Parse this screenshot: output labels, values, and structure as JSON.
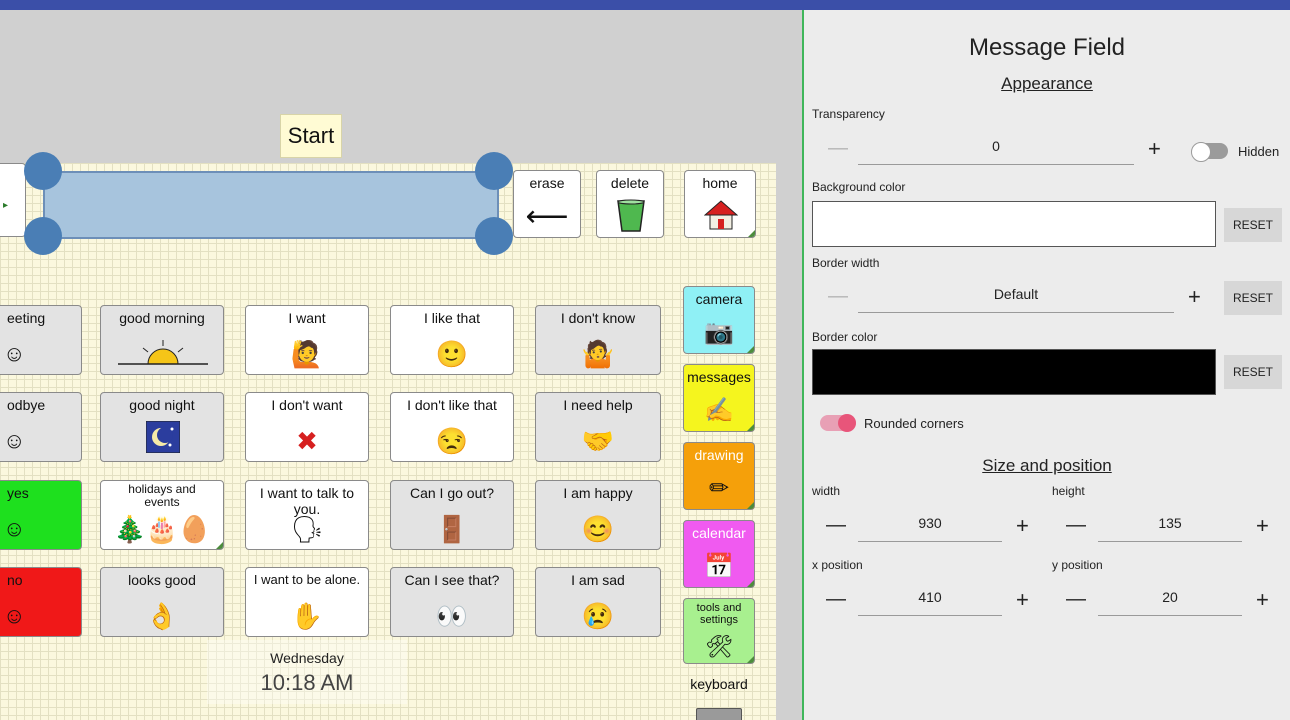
{
  "editor": {
    "start_label": "Start",
    "top_buttons": [
      {
        "label": "erase",
        "symbol": "⟵"
      },
      {
        "label": "delete",
        "symbol": ""
      },
      {
        "label": "home",
        "symbol": ""
      }
    ],
    "grid_rows": [
      [
        {
          "label": "eeting",
          "color": "#e3e3e3"
        },
        {
          "label": "good morning",
          "color": "#e3e3e3"
        },
        {
          "label": "I want",
          "color": "#ffffff"
        },
        {
          "label": "I like that",
          "color": "#ffffff"
        },
        {
          "label": "I don't know",
          "color": "#e3e3e3"
        }
      ],
      [
        {
          "label": "odbye",
          "color": "#e3e3e3"
        },
        {
          "label": "good night",
          "color": "#e3e3e3"
        },
        {
          "label": "I don't want",
          "color": "#ffffff"
        },
        {
          "label": "I don't like that",
          "color": "#ffffff"
        },
        {
          "label": "I need help",
          "color": "#e3e3e3"
        }
      ],
      [
        {
          "label": "yes",
          "color": "#1ee01e"
        },
        {
          "label": "holidays and events",
          "color": "#ffffff"
        },
        {
          "label": "I want to talk to you.",
          "color": "#ffffff"
        },
        {
          "label": "Can I go out?",
          "color": "#e3e3e3"
        },
        {
          "label": "I am happy",
          "color": "#e3e3e3"
        }
      ],
      [
        {
          "label": "no",
          "color": "#f01818"
        },
        {
          "label": "looks good",
          "color": "#e3e3e3"
        },
        {
          "label": "I want to be alone.",
          "color": "#ffffff"
        },
        {
          "label": "Can I see that?",
          "color": "#e3e3e3"
        },
        {
          "label": "I am sad",
          "color": "#e3e3e3"
        }
      ]
    ],
    "side_buttons": [
      {
        "label": "camera",
        "color": "#8ff0f5"
      },
      {
        "label": "messages",
        "color": "#f5f51e"
      },
      {
        "label": "drawing",
        "color": "#f5a00a"
      },
      {
        "label": "calendar",
        "color": "#f05af0"
      },
      {
        "label": "tools and settings",
        "color": "#a8f08f"
      }
    ],
    "keyboard_label": "keyboard",
    "clock": {
      "day": "Wednesday",
      "time": "10:18 AM"
    }
  },
  "panel": {
    "title": "Message Field",
    "appearance_heading": "Appearance",
    "transparency": {
      "label": "Transparency",
      "value": "0",
      "hidden_label": "Hidden"
    },
    "background_color": {
      "label": "Background color",
      "value": "#ffffff",
      "reset": "RESET"
    },
    "border_width": {
      "label": "Border width",
      "value": "Default",
      "reset": "RESET"
    },
    "border_color": {
      "label": "Border color",
      "value": "#000000",
      "reset": "RESET"
    },
    "rounded_corners": {
      "label": "Rounded corners",
      "enabled": true
    },
    "size_heading": "Size and position",
    "width": {
      "label": "width",
      "value": "930"
    },
    "height": {
      "label": "height",
      "value": "135"
    },
    "x_position": {
      "label": "x position",
      "value": "410"
    },
    "y_position": {
      "label": "y position",
      "value": "20"
    },
    "accent_color": "#e8557a"
  }
}
